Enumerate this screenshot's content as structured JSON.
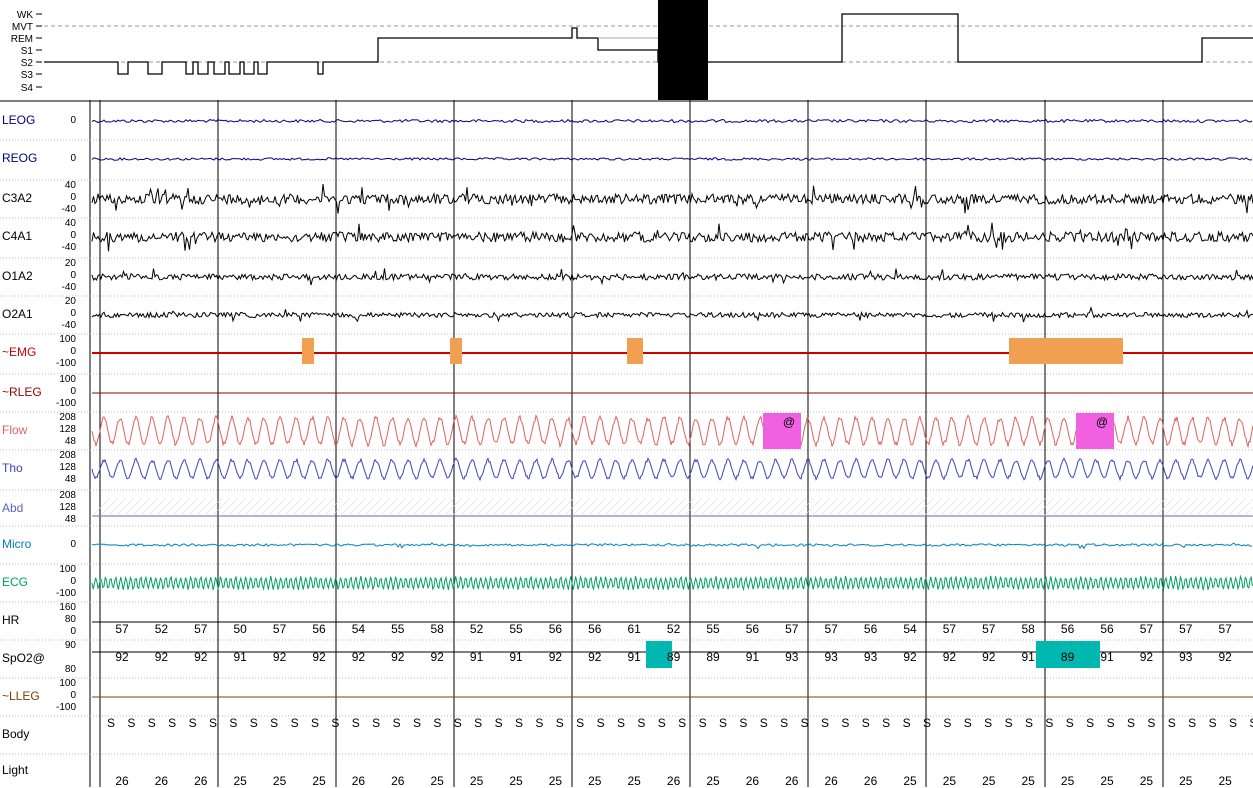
{
  "hypnogram": {
    "stages": [
      "WK",
      "MVT",
      "REM",
      "S1",
      "S2",
      "S3",
      "S4"
    ]
  },
  "channels": [
    {
      "key": "leog",
      "label": "LEOG",
      "color": "#000080",
      "scales": [
        "0"
      ]
    },
    {
      "key": "reog",
      "label": "REOG",
      "color": "#000080",
      "scales": [
        "0"
      ]
    },
    {
      "key": "c3a2",
      "label": "C3A2",
      "color": "#000000",
      "scales": [
        "40",
        "0",
        "-40"
      ]
    },
    {
      "key": "c4a1",
      "label": "C4A1",
      "color": "#000000",
      "scales": [
        "40",
        "0",
        "-40"
      ]
    },
    {
      "key": "o1a2",
      "label": "O1A2",
      "color": "#000000",
      "scales": [
        "20",
        "0",
        "-40"
      ]
    },
    {
      "key": "o2a1",
      "label": "O2A1",
      "color": "#000000",
      "scales": [
        "20",
        "0",
        "-40"
      ]
    },
    {
      "key": "emg",
      "label": "~EMG",
      "color": "#cc0000",
      "scales": [
        "100",
        "0",
        "-100"
      ]
    },
    {
      "key": "rleg",
      "label": "~RLEG",
      "color": "#990000",
      "scales": [
        "100",
        "0",
        "-100"
      ]
    },
    {
      "key": "flow",
      "label": "Flow",
      "color": "#e06060",
      "scales": [
        "208",
        "128",
        "48"
      ]
    },
    {
      "key": "tho",
      "label": "Tho",
      "color": "#4040c0",
      "scales": [
        "208",
        "128",
        "48"
      ]
    },
    {
      "key": "abd",
      "label": "Abd",
      "color": "#6060c0",
      "scales": [
        "208",
        "128",
        "48"
      ]
    },
    {
      "key": "micro",
      "label": "Micro",
      "color": "#0080c0",
      "scales": [
        "0"
      ]
    },
    {
      "key": "ecg",
      "label": "ECG",
      "color": "#00a060",
      "scales": [
        "100",
        "0",
        "-100"
      ]
    },
    {
      "key": "hr",
      "label": "HR",
      "color": "#000000",
      "scales": [
        "160",
        "80",
        "0"
      ]
    },
    {
      "key": "spo2",
      "label": "SpO2@",
      "color": "#000000",
      "scales": [
        "90",
        "80"
      ]
    },
    {
      "key": "lleg",
      "label": "~LLEG",
      "color": "#804000",
      "scales": [
        "100",
        "0",
        "-100"
      ]
    },
    {
      "key": "body",
      "label": "Body",
      "color": "#000000",
      "scales": []
    },
    {
      "key": "light",
      "label": "Light",
      "color": "#000000",
      "scales": []
    }
  ],
  "hr_values": [
    "57",
    "52",
    "57",
    "50",
    "57",
    "56",
    "54",
    "55",
    "58",
    "52",
    "55",
    "56",
    "56",
    "61",
    "52",
    "55",
    "56",
    "57",
    "57",
    "56",
    "54",
    "57",
    "57",
    "58",
    "56",
    "56",
    "57",
    "57",
    "57"
  ],
  "spo2_values": [
    "92",
    "92",
    "92",
    "91",
    "92",
    "92",
    "92",
    "92",
    "92",
    "91",
    "91",
    "92",
    "92",
    "91",
    "89",
    "89",
    "91",
    "93",
    "93",
    "93",
    "92",
    "92",
    "92",
    "91",
    "89",
    "91",
    "92",
    "93",
    "92"
  ],
  "body_values": [
    "S",
    "S",
    "S",
    "S",
    "S",
    "S",
    "S",
    "S",
    "S",
    "S",
    "S",
    "S",
    "S",
    "S",
    "S",
    "S",
    "S",
    "S",
    "S",
    "S",
    "S",
    "S",
    "S",
    "S",
    "S",
    "S",
    "S",
    "S",
    "S",
    "S",
    "S",
    "S",
    "S",
    "S",
    "S",
    "S",
    "S",
    "S",
    "S",
    "S",
    "S",
    "S",
    "S",
    "S",
    "S",
    "S",
    "S",
    "S",
    "S",
    "S",
    "S",
    "S",
    "S",
    "S",
    "S",
    "S",
    "S",
    "S"
  ],
  "light_values": [
    "26",
    "26",
    "26",
    "25",
    "25",
    "25",
    "26",
    "26",
    "25",
    "25",
    "25",
    "25",
    "25",
    "25",
    "26",
    "25",
    "26",
    "26",
    "26",
    "26",
    "25",
    "25",
    "25",
    "25",
    "25",
    "25",
    "25",
    "25",
    "25"
  ],
  "annotation_marker": "@",
  "colors": {
    "emg_event": "#f0a050",
    "flow_event": "#f060e0",
    "spo2_event": "#00b8b0",
    "hypnogram_block": "#000000"
  }
}
